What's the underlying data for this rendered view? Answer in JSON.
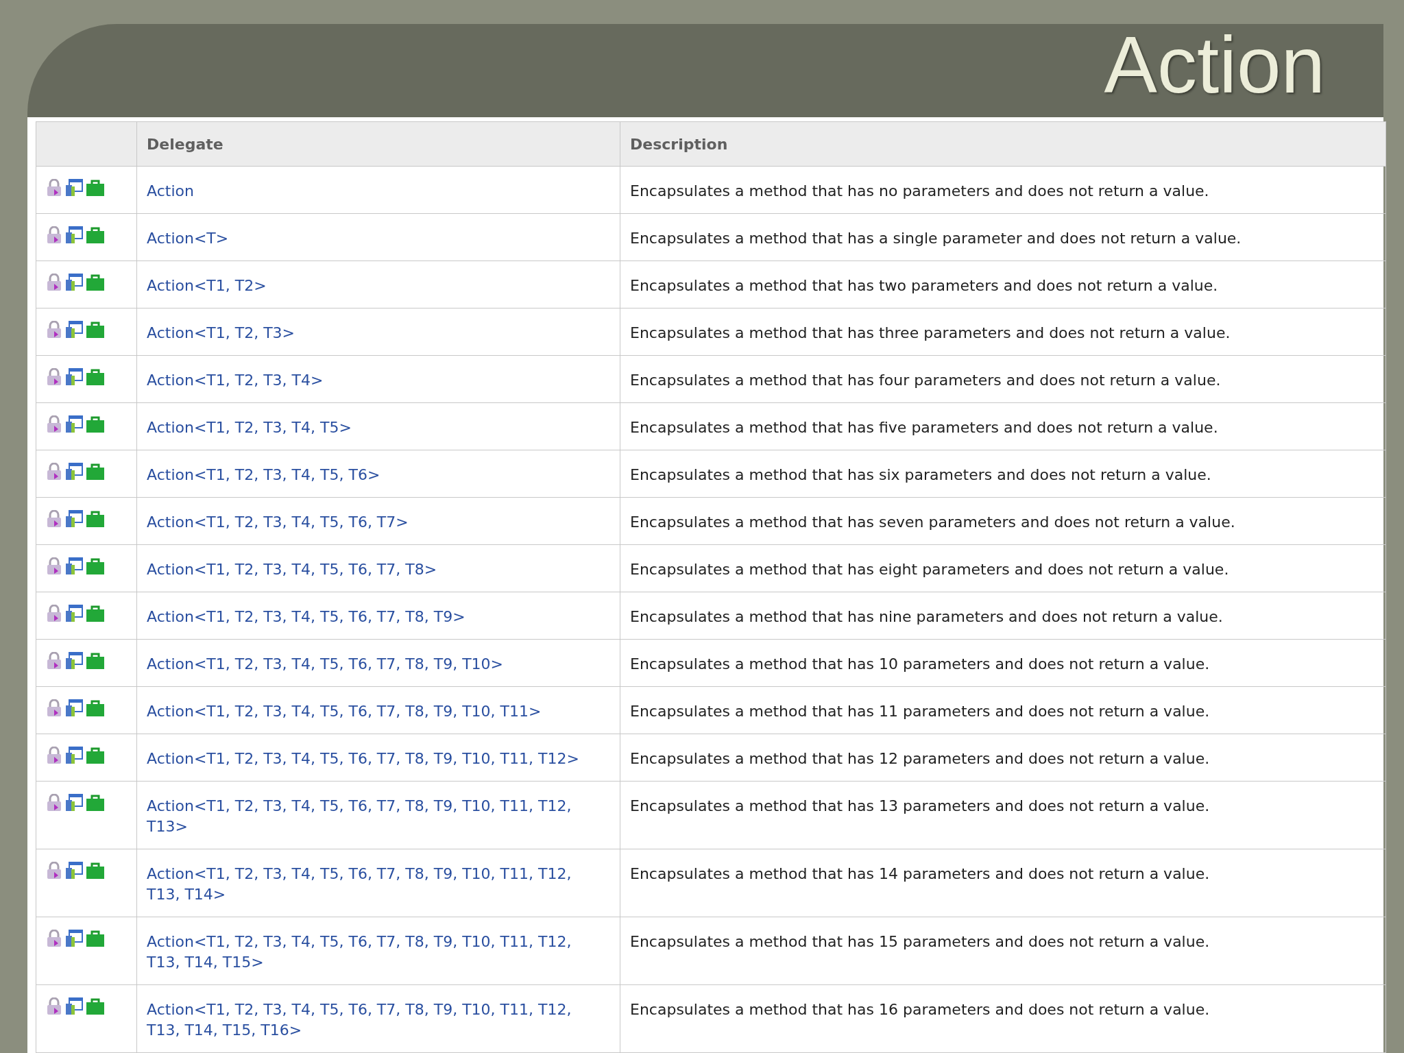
{
  "title": "Action",
  "table": {
    "columns": [
      "Delegate",
      "Description"
    ],
    "rows": [
      {
        "delegate": "Action",
        "description": "Encapsulates a method that has no parameters and does not return a value."
      },
      {
        "delegate": "Action<T>",
        "description": "Encapsulates a method that has a single parameter and does not return a value."
      },
      {
        "delegate": "Action<T1, T2>",
        "description": "Encapsulates a method that has two parameters and does not return a value."
      },
      {
        "delegate": "Action<T1, T2, T3>",
        "description": "Encapsulates a method that has three parameters and does not return a value."
      },
      {
        "delegate": "Action<T1, T2, T3, T4>",
        "description": "Encapsulates a method that has four parameters and does not return a value."
      },
      {
        "delegate": "Action<T1, T2, T3, T4, T5>",
        "description": "Encapsulates a method that has five parameters and does not return a value."
      },
      {
        "delegate": "Action<T1, T2, T3, T4, T5, T6>",
        "description": "Encapsulates a method that has six parameters and does not return a value."
      },
      {
        "delegate": "Action<T1, T2, T3, T4, T5, T6, T7>",
        "description": "Encapsulates a method that has seven parameters and does not return a value."
      },
      {
        "delegate": "Action<T1, T2, T3, T4, T5, T6, T7, T8>",
        "description": "Encapsulates a method that has eight parameters and does not return a value."
      },
      {
        "delegate": "Action<T1, T2, T3, T4, T5, T6, T7, T8, T9>",
        "description": "Encapsulates a method that has nine parameters and does not return a value."
      },
      {
        "delegate": "Action<T1, T2, T3, T4, T5, T6, T7, T8, T9, T10>",
        "description": "Encapsulates a method that has 10 parameters and does not return a value."
      },
      {
        "delegate": "Action<T1, T2, T3, T4, T5, T6, T7, T8, T9, T10, T11>",
        "description": "Encapsulates a method that has 11 parameters and does not return a value."
      },
      {
        "delegate": "Action<T1, T2, T3, T4, T5, T6, T7, T8, T9, T10, T11, T12>",
        "description": "Encapsulates a method that has 12 parameters and does not return a value."
      },
      {
        "delegate": "Action<T1, T2, T3, T4, T5, T6, T7, T8, T9, T10, T11, T12, T13>",
        "description": "Encapsulates a method that has 13 parameters and does not return a value."
      },
      {
        "delegate": "Action<T1, T2, T3, T4, T5, T6, T7, T8, T9, T10, T11, T12, T13, T14>",
        "description": "Encapsulates a method that has 14 parameters and does not return a value."
      },
      {
        "delegate": "Action<T1, T2, T3, T4, T5, T6, T7, T8, T9, T10, T11, T12, T13, T14, T15>",
        "description": "Encapsulates a method that has 15 parameters and does not return a value."
      },
      {
        "delegate": "Action<T1, T2, T3, T4, T5, T6, T7, T8, T9, T10, T11, T12, T13, T14, T15, T16>",
        "description": "Encapsulates a method that has 16 parameters and does not return a value."
      }
    ]
  }
}
